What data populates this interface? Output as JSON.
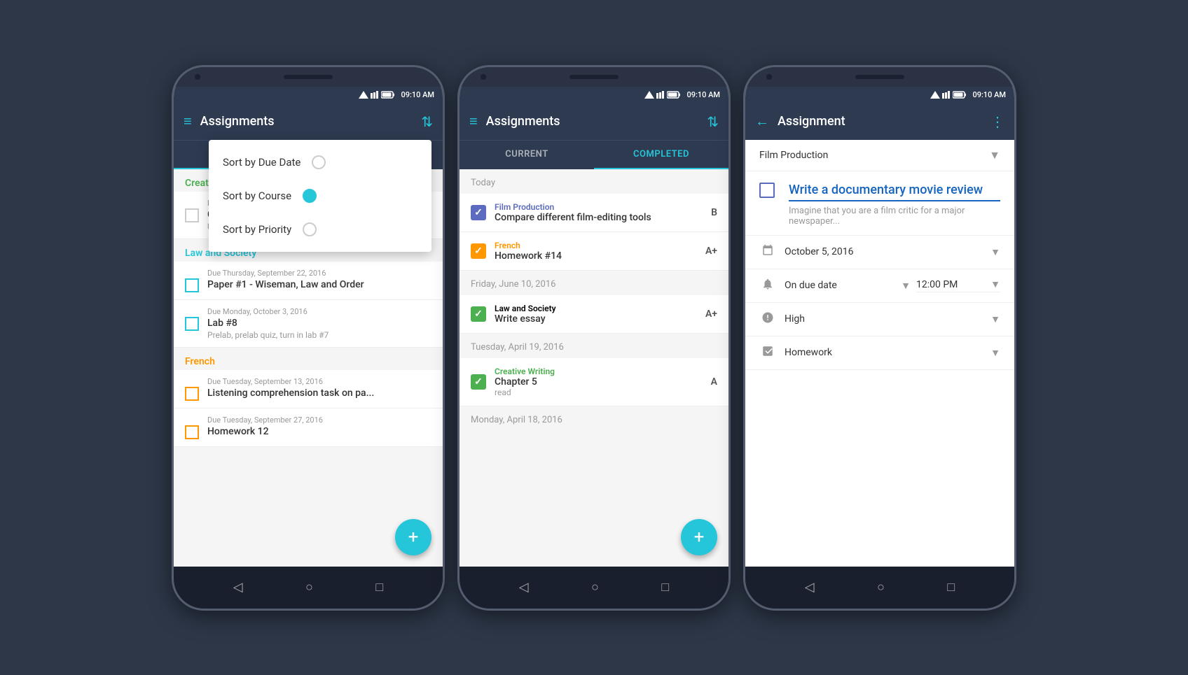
{
  "app": {
    "title": "Assignments",
    "title_detail": "Assignment",
    "time": "09:10 AM"
  },
  "screen1": {
    "tab_current": "CURRENT",
    "tab_completed": "COMPLETED",
    "active_tab": "current",
    "dropdown": {
      "items": [
        {
          "label": "Sort by Due Date",
          "selected": false
        },
        {
          "label": "Sort by Course",
          "selected": true
        },
        {
          "label": "Sort by Priority",
          "selected": false
        }
      ]
    },
    "categories": [
      {
        "name": "Creative Writing",
        "color": "green",
        "assignments": [
          {
            "due": "Due Tuesday, Sep...",
            "title": "Compose a po...",
            "desc": "Use the Imagist handout and sample poems...",
            "checkColor": "green"
          }
        ]
      },
      {
        "name": "Law and Society",
        "color": "teal",
        "assignments": [
          {
            "due": "Due Thursday, September 22, 2016",
            "title": "Paper #1 - Wiseman, Law and Order",
            "desc": "",
            "checkColor": "teal"
          },
          {
            "due": "Due Monday, October 3, 2016",
            "title": "Lab #8",
            "desc": "Prelab, prelab quiz, turn in lab #7",
            "checkColor": "teal"
          }
        ]
      },
      {
        "name": "French",
        "color": "orange",
        "assignments": [
          {
            "due": "Due Tuesday, September 13, 2016",
            "title": "Listening comprehension task on pa...",
            "desc": "",
            "checkColor": "orange"
          },
          {
            "due": "Due Tuesday, September 27, 2016",
            "title": "Homework 12",
            "desc": "",
            "checkColor": "orange"
          }
        ]
      }
    ],
    "fab_label": "+"
  },
  "screen2": {
    "tab_current": "CURRENT",
    "tab_completed": "COMPLETED",
    "active_tab": "completed",
    "sections": [
      {
        "date": "Today",
        "items": [
          {
            "course": "Film Production",
            "courseColor": "blue",
            "title": "Compare different film-editing tools",
            "grade": "B",
            "checkColor": "blue"
          },
          {
            "course": "French",
            "courseColor": "orange",
            "title": "Homework #14",
            "grade": "A+",
            "checkColor": "orange"
          }
        ]
      },
      {
        "date": "Friday, June 10, 2016",
        "items": [
          {
            "course": "Law and Society",
            "courseColor": "teal",
            "title": "Write essay",
            "grade": "A+",
            "checkColor": "teal"
          }
        ]
      },
      {
        "date": "Tuesday, April 19, 2016",
        "items": [
          {
            "course": "Creative Writing",
            "courseColor": "green",
            "title": "Chapter 5",
            "subtitle": "read",
            "grade": "A",
            "checkColor": "green"
          }
        ]
      },
      {
        "date": "Monday, April 18, 2016",
        "items": []
      }
    ],
    "fab_label": "+"
  },
  "screen3": {
    "course_dropdown": "Film Production",
    "assignment_title": "Write a documentary movie review",
    "assignment_desc": "Imagine that you are a film critic for a major newspaper...",
    "date": "October 5, 2016",
    "reminder": "On due date",
    "time": "12:00 PM",
    "priority": "High",
    "category": "Homework"
  },
  "nav": {
    "back": "◁",
    "home": "○",
    "square": "□"
  }
}
